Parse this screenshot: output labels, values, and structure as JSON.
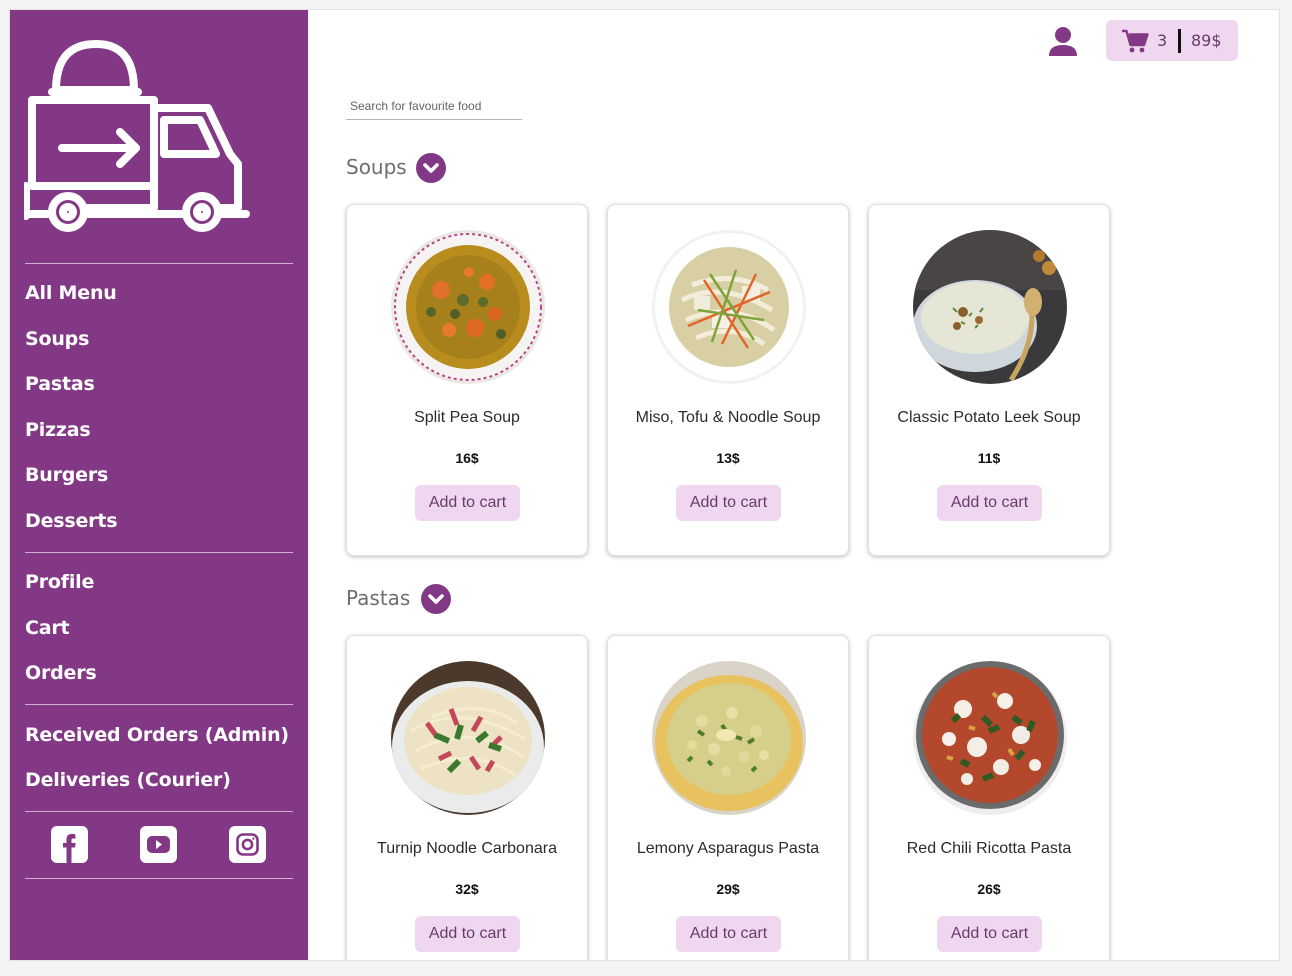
{
  "sidebar": {
    "nav_main": [
      {
        "label": "All Menu"
      },
      {
        "label": "Soups"
      },
      {
        "label": "Pastas"
      },
      {
        "label": "Pizzas"
      },
      {
        "label": "Burgers"
      },
      {
        "label": "Desserts"
      }
    ],
    "nav_account": [
      {
        "label": "Profile"
      },
      {
        "label": "Cart"
      },
      {
        "label": "Orders"
      }
    ],
    "nav_roles": [
      {
        "label": "Received Orders (Admin)"
      },
      {
        "label": "Deliveries (Courier)"
      }
    ],
    "social": [
      "facebook-icon",
      "youtube-icon",
      "instagram-icon"
    ]
  },
  "header": {
    "cart_count": "3",
    "cart_total": "89$"
  },
  "search": {
    "placeholder": "Search for favourite food",
    "value": ""
  },
  "colors": {
    "sidebar": "#833885",
    "accent_light": "#efd8ef",
    "accent_text": "#6a3a6b"
  },
  "sections": [
    {
      "title": "Soups",
      "items": [
        {
          "name": "Split Pea Soup",
          "price": "16$",
          "button": "Add to cart"
        },
        {
          "name": "Miso, Tofu & Noodle Soup",
          "price": "13$",
          "button": "Add to cart"
        },
        {
          "name": "Classic Potato Leek Soup",
          "price": "11$",
          "button": "Add to cart"
        }
      ]
    },
    {
      "title": "Pastas",
      "items": [
        {
          "name": "Turnip Noodle Carbonara",
          "price": "32$",
          "button": "Add to cart"
        },
        {
          "name": "Lemony Asparagus Pasta",
          "price": "29$",
          "button": "Add to cart"
        },
        {
          "name": "Red Chili Ricotta Pasta",
          "price": "26$",
          "button": "Add to cart"
        }
      ]
    }
  ]
}
